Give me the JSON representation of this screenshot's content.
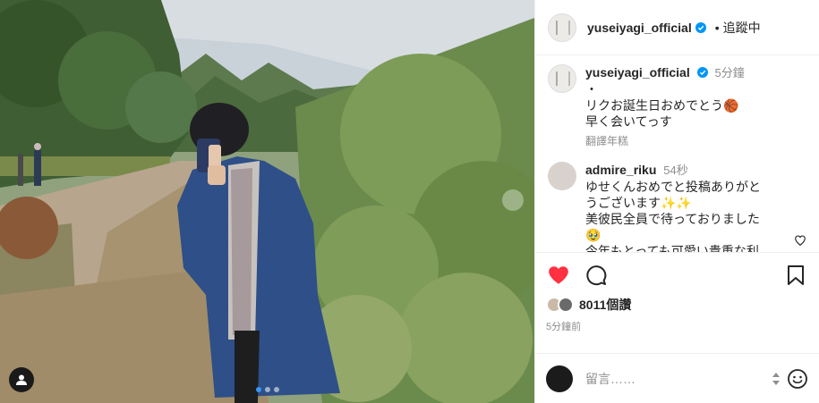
{
  "header": {
    "username": "yuseiyagi_official",
    "separator": "•",
    "follow_status": "追蹤中"
  },
  "caption": {
    "username": "yuseiyagi_official",
    "time": "5分鐘",
    "lines": [
      "・",
      "リクお誕生日おめでとう🏀",
      "早く会いてっす"
    ],
    "translate_label": "翻譯年糕"
  },
  "comment1": {
    "username": "admire_riku",
    "time": "54秒",
    "lines": [
      "ゆせくんおめでと投稿ありがと",
      "うございます✨✨",
      "美彼民全員で待っておりました",
      "🥹",
      "今年もとっても可愛い貴重な利"
    ]
  },
  "actions": {
    "likes": "8011個讚",
    "post_time": "5分鐘前"
  },
  "add_comment": {
    "placeholder": "留言……"
  },
  "colors": {
    "like_red": "#ff3040",
    "verified_blue": "#0095f6",
    "carousel_active": "#3897f0"
  },
  "icons": [
    "user-tag-icon",
    "heart-icon",
    "comment-icon",
    "bookmark-icon",
    "verified-icon",
    "emoji-icon",
    "sort-icon"
  ]
}
